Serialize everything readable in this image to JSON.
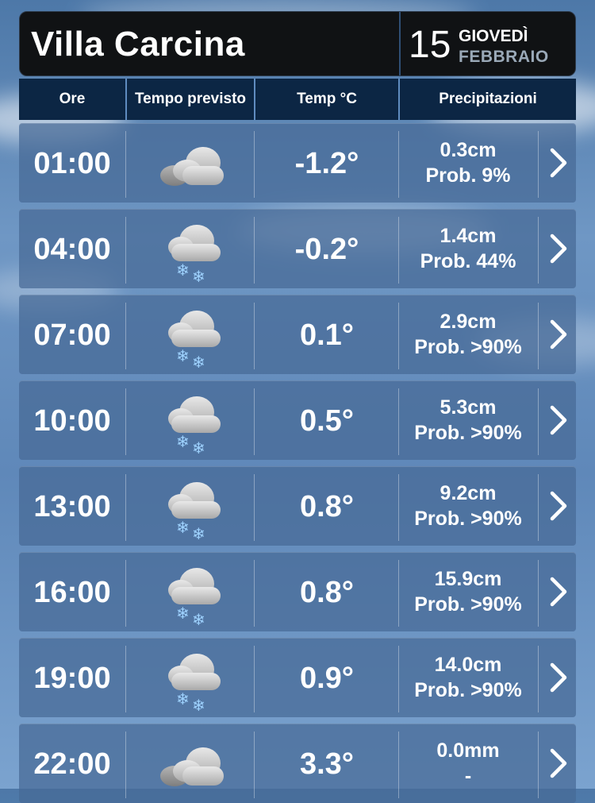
{
  "header": {
    "city": "Villa Carcina",
    "day_number": "15",
    "day_name": "GIOVEDÌ",
    "month": "FEBBRAIO"
  },
  "columns": {
    "time": "Ore",
    "forecast": "Tempo previsto",
    "temp": "Temp °C",
    "precip": "Precipitazioni"
  },
  "rows": [
    {
      "time": "01:00",
      "icon": "cloudy-icon",
      "temp": "-1.2°",
      "amount": "0.3cm",
      "prob": "Prob. 9%"
    },
    {
      "time": "04:00",
      "icon": "snow-icon",
      "temp": "-0.2°",
      "amount": "1.4cm",
      "prob": "Prob. 44%"
    },
    {
      "time": "07:00",
      "icon": "snow-icon",
      "temp": "0.1°",
      "amount": "2.9cm",
      "prob": "Prob. >90%"
    },
    {
      "time": "10:00",
      "icon": "snow-icon",
      "temp": "0.5°",
      "amount": "5.3cm",
      "prob": "Prob. >90%"
    },
    {
      "time": "13:00",
      "icon": "snow-icon",
      "temp": "0.8°",
      "amount": "9.2cm",
      "prob": "Prob. >90%"
    },
    {
      "time": "16:00",
      "icon": "snow-icon",
      "temp": "0.8°",
      "amount": "15.9cm",
      "prob": "Prob. >90%"
    },
    {
      "time": "19:00",
      "icon": "snow-icon",
      "temp": "0.9°",
      "amount": "14.0cm",
      "prob": "Prob. >90%"
    },
    {
      "time": "22:00",
      "icon": "cloudy-icon",
      "temp": "3.3°",
      "amount": "0.0mm",
      "prob": "-"
    }
  ]
}
